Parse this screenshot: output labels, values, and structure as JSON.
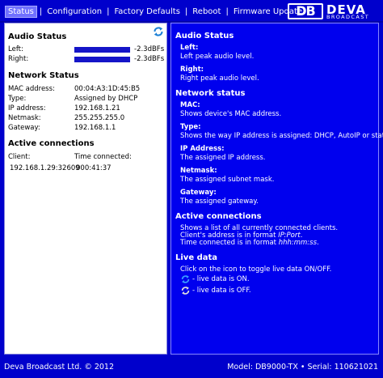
{
  "nav": {
    "tabs": [
      "Status",
      "Configuration",
      "Factory Defaults",
      "Reboot",
      "Firmware Update"
    ],
    "active": "Status"
  },
  "brand": {
    "mark": "DB",
    "name": "DEVA",
    "sub": "BROADCAST"
  },
  "left": {
    "audio": {
      "title": "Audio Status",
      "left_label": "Left:",
      "left_value": "-2.3dBFs",
      "left_level": 0.96,
      "right_label": "Right:",
      "right_value": "-2.3dBFs",
      "right_level": 0.96
    },
    "network": {
      "title": "Network Status",
      "rows": [
        {
          "label": "MAC address:",
          "value": "00:04:A3:1D:45:B5"
        },
        {
          "label": "Type:",
          "value": "Assigned by DHCP"
        },
        {
          "label": "IP address:",
          "value": "192.168.1.21"
        },
        {
          "label": "Netmask:",
          "value": "255.255.255.0"
        },
        {
          "label": "Gateway:",
          "value": "192.168.1.1"
        }
      ]
    },
    "connections": {
      "title": "Active connections",
      "col_client": "Client:",
      "col_time": "Time connected:",
      "rows": [
        {
          "client": "192.168.1.29:32609",
          "time": "000:41:37"
        }
      ]
    }
  },
  "help": {
    "audio_title": "Audio Status",
    "left_t": "Left:",
    "left_d": "Left peak audio level.",
    "right_t": "Right:",
    "right_d": "Right peak audio level.",
    "net_title": "Network status",
    "mac_t": "MAC:",
    "mac_d": "Shows device's MAC address.",
    "type_t": "Type:",
    "type_d": "Shows the way IP address is assigned: DHCP, AutoIP or static.",
    "ip_t": "IP Address:",
    "ip_d": "The assigned IP address.",
    "nm_t": "Netmask:",
    "nm_d": "The assigned subnet mask.",
    "gw_t": "Gateway:",
    "gw_d": "The assigned gateway.",
    "ac_title": "Active connections",
    "ac_d1": "Shows a list of all currently connected clients.",
    "ac_d2_pre": "Client's address is in format ",
    "ac_d2_em": "IP:Port",
    "ac_d3_pre": "Time connected is in format ",
    "ac_d3_em": "hhh:mm:ss",
    "live_title": "Live data",
    "live_d": "Click on the icon to toggle live data ON/OFF.",
    "live_on": "- live data is ON.",
    "live_off": "- live data is OFF."
  },
  "footer": {
    "copyright": "Deva Broadcast Ltd. © 2012",
    "model": "Model: DB9000-TX • Serial: 110621021"
  },
  "colors": {
    "background": "#0000cc",
    "help_panel": "#0000ee",
    "level_bar": "#1515c8",
    "icon_on": "#1a7fd6",
    "icon_off": "#666666"
  },
  "icons": {
    "refresh": "refresh-icon",
    "live_on": "live-on-icon",
    "live_off": "live-off-icon"
  }
}
